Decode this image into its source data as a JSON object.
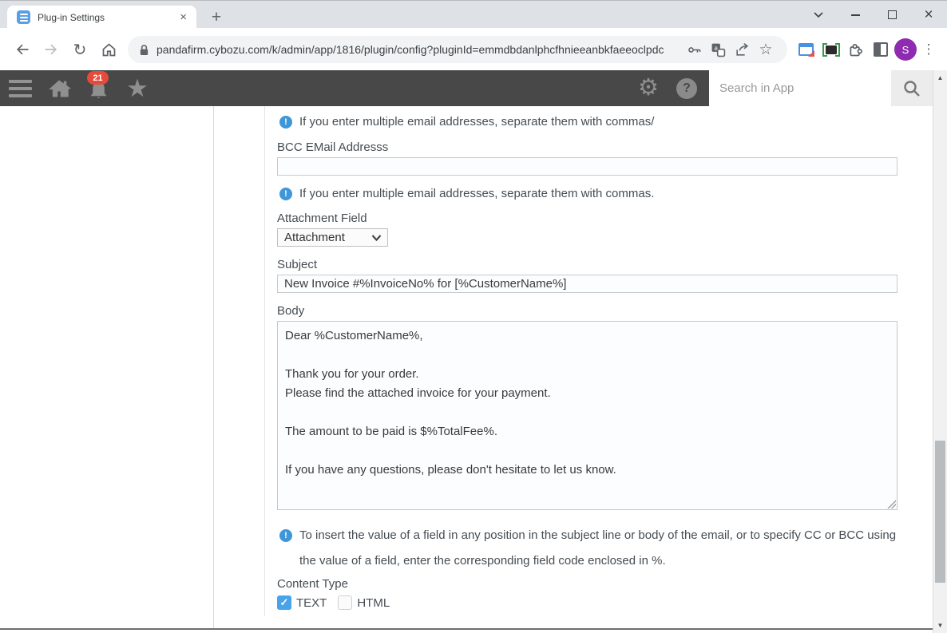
{
  "browser": {
    "tab_title": "Plug-in Settings",
    "tab_close_glyph": "×",
    "new_tab_glyph": "+",
    "window_close_glyph": "×",
    "reload_glyph": "↻",
    "bookmark_star_glyph": "☆",
    "kebab_glyph": "⋮",
    "url": "pandafirm.cybozu.com/k/admin/app/1816/plugin/config?pluginId=emmdbdanlphcfhnieeanbkfaeeoclpdc",
    "avatar_letter": "S"
  },
  "app_header": {
    "notification_badge": "21",
    "favorites_star_glyph": "★",
    "gear_glyph": "⚙",
    "help_glyph": "?",
    "search": {
      "placeholder": "Search in App"
    }
  },
  "scrollbar": {
    "up_glyph": "▲",
    "down_glyph": "▼"
  },
  "form": {
    "info_glyph": "!",
    "check_glyph": "✓",
    "info_top": "If you enter multiple email addresses, separate them with commas/",
    "bcc": {
      "label": "BCC EMail Addresss",
      "value": ""
    },
    "info_bcc": "If you enter multiple email addresses, separate them with commas.",
    "attachment": {
      "label": "Attachment Field",
      "value": "Attachment"
    },
    "subject": {
      "label": "Subject",
      "value": "New Invoice #%InvoiceNo% for [%CustomerName%]"
    },
    "body": {
      "label": "Body",
      "value": "Dear %CustomerName%,\n\nThank you for your order.\nPlease find the attached invoice for your payment.\n\nThe amount to be paid is $%TotalFee%.\n\nIf you have any questions, please don't hesitate to let us know."
    },
    "info_field_code": "To insert the value of a field in any position in the subject line or body of the email, or to specify CC or BCC using the value of a field, enter the corresponding field code enclosed in %.",
    "content_type": {
      "label": "Content Type",
      "options": [
        {
          "label": "TEXT",
          "checked": true
        },
        {
          "label": "HTML",
          "checked": false
        }
      ]
    }
  },
  "colors": {
    "app_header_bg": "#484848",
    "info_icon_blue": "#3f97d9",
    "badge_red": "#e64a3b",
    "checkbox_blue": "#47a3ea",
    "avatar_purple": "#8e2bb0",
    "favicon_blue": "#5b9fe3"
  }
}
